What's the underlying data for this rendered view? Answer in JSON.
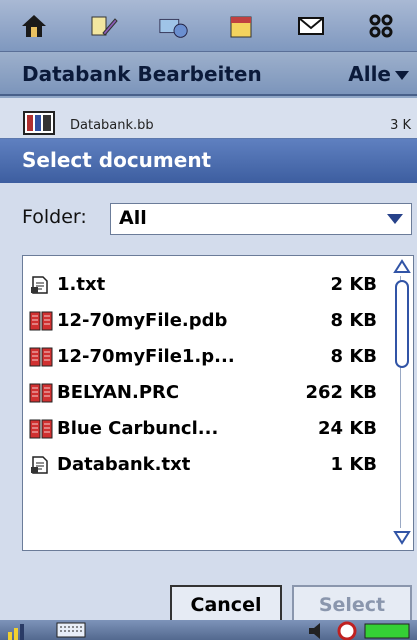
{
  "top_bar": {
    "icons": [
      "home-icon",
      "tools-icon",
      "sync-icon",
      "calendar-icon",
      "mail-icon",
      "apps-icon"
    ]
  },
  "header": {
    "title": "Databank Bearbeiten",
    "filter": "Alle"
  },
  "background_row": {
    "name": "Databank.bb",
    "size": "3 K"
  },
  "dialog": {
    "title": "Select document",
    "folder_label": "Folder:",
    "folder_value": "All",
    "files": [
      {
        "icon": "text-file-icon",
        "name": "1.txt",
        "size": "2 KB"
      },
      {
        "icon": "book-icon",
        "name": "12-70myFile.pdb",
        "size": "8 KB"
      },
      {
        "icon": "book-icon",
        "name": "12-70myFile1.p...",
        "size": "8 KB"
      },
      {
        "icon": "book-icon",
        "name": "BELYAN.PRC",
        "size": "262 KB"
      },
      {
        "icon": "book-icon",
        "name": "Blue Carbuncl...",
        "size": "24 KB"
      },
      {
        "icon": "text-file-icon",
        "name": "Databank.txt",
        "size": "1 KB"
      }
    ],
    "cancel_label": "Cancel",
    "select_label": "Select"
  },
  "status_bar": {
    "icons": [
      "signal-icon",
      "keyboard-icon",
      "volume-icon",
      "clock-icon",
      "battery-icon"
    ]
  },
  "colors": {
    "dialog_title_bg": "#4a6bb0",
    "accent": "#3154a6"
  }
}
